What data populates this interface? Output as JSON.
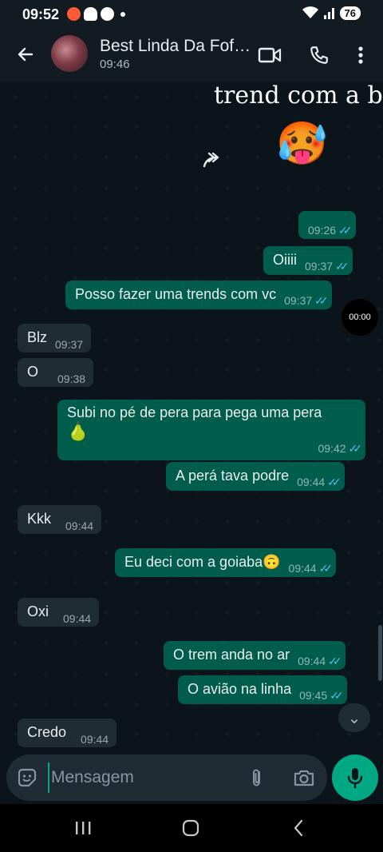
{
  "status_bar": {
    "time": "09:52",
    "battery": "76",
    "icons": [
      "recorder-icon",
      "snapchat-icon",
      "message-icon",
      "wifi-icon",
      "signal-icon",
      "battery-icon"
    ]
  },
  "header": {
    "contact_name": "Best Linda Da Fofura",
    "last_seen": "09:46",
    "icons": [
      "back-arrow-icon",
      "video-call-icon",
      "phone-icon",
      "more-vert-icon"
    ]
  },
  "sticker_text": "trend com a b",
  "sticker_emoji": "🥵",
  "duration_badge": "00:00",
  "messages": [
    {
      "dir": "out",
      "text": "",
      "time": "09:26",
      "read": true
    },
    {
      "dir": "out",
      "text": "Oiiii",
      "time": "09:37",
      "read": true
    },
    {
      "dir": "out",
      "text": "Posso fazer uma trends com vc",
      "time": "09:37",
      "read": true
    },
    {
      "dir": "in",
      "text": "Blz",
      "time": "09:37"
    },
    {
      "dir": "in",
      "text": "O",
      "time": "09:38"
    },
    {
      "dir": "out",
      "text": "Subi no pé de pera para pega uma pera",
      "text2": "🍐",
      "time": "09:42",
      "read": true
    },
    {
      "dir": "out",
      "text": "A perá tava podre",
      "time": "09:44",
      "read": true
    },
    {
      "dir": "in",
      "text": "Kkk",
      "time": "09:44"
    },
    {
      "dir": "out",
      "text": "Eu deci com a goiaba🙃",
      "time": "09:44",
      "read": true
    },
    {
      "dir": "in",
      "text": "Oxi",
      "time": "09:44"
    },
    {
      "dir": "out",
      "text": "O trem anda no ar",
      "time": "09:44",
      "read": true
    },
    {
      "dir": "out",
      "text": "O avião na linha",
      "time": "09:45",
      "read": true
    },
    {
      "dir": "in",
      "text": "Credo",
      "time": "09:44"
    }
  ],
  "input": {
    "placeholder": "Mensagem"
  },
  "colors": {
    "outgoing_bubble": "#005c4b",
    "incoming_bubble": "#202c33",
    "accent": "#00a884",
    "read_ticks": "#53bdeb"
  }
}
